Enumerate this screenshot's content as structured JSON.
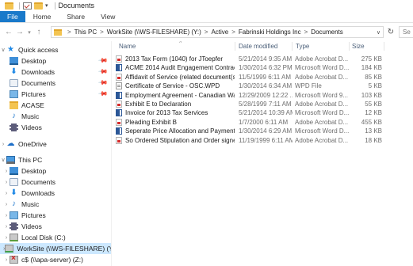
{
  "window": {
    "title": "Documents",
    "quick_access_dropdown": "▾"
  },
  "ribbon": {
    "tabs": [
      "File",
      "Home",
      "Share",
      "View"
    ]
  },
  "address": {
    "crumbs": [
      "This PC",
      "WorkSite (\\\\WS-FILESHARE) (Y:)",
      "Active",
      "Fabrinski Holdings Inc",
      "Documents"
    ],
    "separator": ">",
    "search_placeholder": "Se"
  },
  "nav": {
    "quick_access": "Quick access",
    "qa_items": [
      "Desktop",
      "Downloads",
      "Documents",
      "Pictures",
      "ACASE",
      "Music",
      "Videos"
    ],
    "onedrive": "OneDrive",
    "this_pc": "This PC",
    "pc_items": [
      "Desktop",
      "Documents",
      "Downloads",
      "Music",
      "Pictures",
      "Videos",
      "Local Disk (C:)",
      "WorkSite (\\\\WS-FILESHARE) (Y:)",
      "c$ (\\\\apa-server) (Z:)"
    ]
  },
  "list": {
    "columns": {
      "name": "Name",
      "date": "Date modified",
      "type": "Type",
      "size": "Size"
    },
    "files": [
      {
        "name": "2013 Tax Form (1040) for JToepfer",
        "date": "5/21/2014 9:35 AM",
        "type": "Adobe Acrobat D...",
        "size": "275 KB",
        "icon": "pdf"
      },
      {
        "name": "ACME 2014 Audit Engagement Contract",
        "date": "1/30/2014 6:32 PM",
        "type": "Microsoft Word D...",
        "size": "184 KB",
        "icon": "word"
      },
      {
        "name": "Affidavit of Service (related document(s)...",
        "date": "11/5/1999 6:11 AM",
        "type": "Adobe Acrobat D...",
        "size": "85 KB",
        "icon": "pdf"
      },
      {
        "name": "Certificate of Service - OSC.WPD",
        "date": "1/30/2014 6:34 AM",
        "type": "WPD File",
        "size": "5 KB",
        "icon": "wpd"
      },
      {
        "name": "Employment Agreement - Canadian Was...",
        "date": "12/29/2009 12:22 ...",
        "type": "Microsoft Word 9...",
        "size": "103 KB",
        "icon": "word"
      },
      {
        "name": "Exhibit E to Declaration",
        "date": "5/28/1999 7:11 AM",
        "type": "Adobe Acrobat D...",
        "size": "55 KB",
        "icon": "pdf"
      },
      {
        "name": "Invoice for 2013 Tax Services",
        "date": "5/21/2014 10:39 AM",
        "type": "Microsoft Word D...",
        "size": "12 KB",
        "icon": "word"
      },
      {
        "name": "Pleading Exhibit B",
        "date": "1/7/2000 6:11 AM",
        "type": "Adobe Acrobat D...",
        "size": "455 KB",
        "icon": "pdf"
      },
      {
        "name": "Seperate Price Allocation and Payment",
        "date": "1/30/2014 6:29 AM",
        "type": "Microsoft Word D...",
        "size": "13 KB",
        "icon": "word"
      },
      {
        "name": "So Ordered Stipulation and Order signed ...",
        "date": "11/19/1999 6:11 AM",
        "type": "Adobe Acrobat D...",
        "size": "18 KB",
        "icon": "pdf"
      }
    ]
  }
}
